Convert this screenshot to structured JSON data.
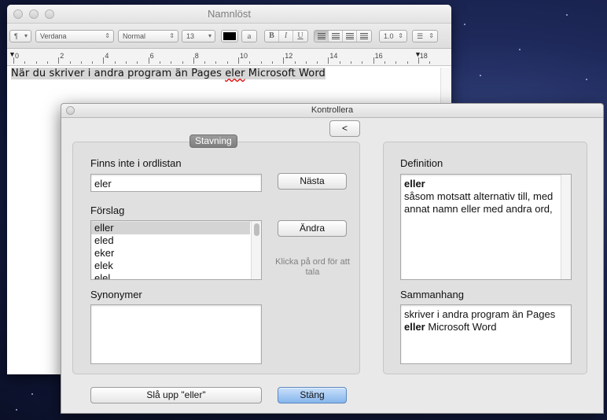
{
  "document": {
    "title": "Namnlöst",
    "toolbar": {
      "paragraph_style": "¶",
      "font": "Verdana",
      "typeface": "Normal",
      "size": "13",
      "char_style_a": "a",
      "bold": "B",
      "italic": "I",
      "underline": "U",
      "line_spacing": "1.0",
      "list": "☰"
    },
    "ruler_numbers": [
      "0",
      "2",
      "4",
      "6",
      "8",
      "10",
      "12",
      "14",
      "16",
      "18"
    ],
    "body_before": "När du skriver i andra program än Pages ",
    "body_misspelled": "eler",
    "body_after": " Microsoft Word"
  },
  "panel": {
    "title": "Kontrollera",
    "back_label": "<",
    "section_tab": "Stavning",
    "not_in_dictionary_label": "Finns inte i ordlistan",
    "not_in_dictionary_value": "eler",
    "next_label": "Nästa",
    "suggestions_label": "Förslag",
    "suggestions": [
      "eller",
      "eled",
      "eker",
      "elek",
      "elel"
    ],
    "change_label": "Ändra",
    "hint": "Klicka på ord för att tala",
    "synonyms_label": "Synonymer",
    "definition_label": "Definition",
    "definition_word": "eller",
    "definition_text": "såsom motsatt alternativ till, med annat namn eller med andra ord,",
    "context_label": "Sammanhang",
    "context_before": "skriver i andra program än Pages ",
    "context_word": "eller",
    "context_after": " Microsoft Word",
    "lookup_label": "Slå upp \"eller\"",
    "close_label": "Stäng"
  },
  "colors": {
    "default_button": "#86b6ec",
    "misspell_underline": "#dd0000",
    "section_tab": "#8a8a8a"
  }
}
